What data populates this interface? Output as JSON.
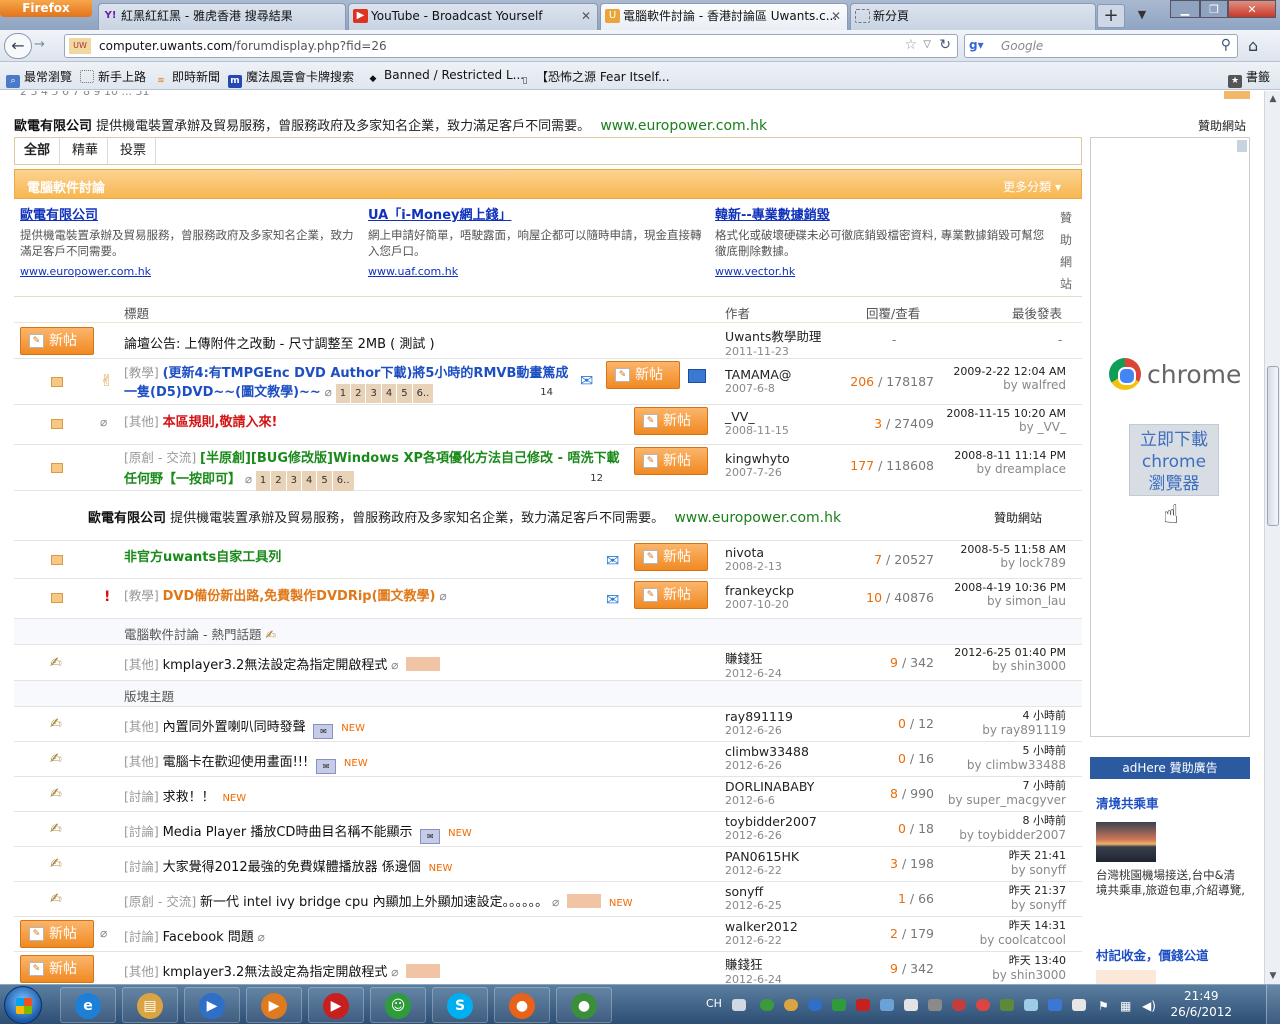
{
  "browser": {
    "app_button": "Firefox",
    "tabs": [
      {
        "label": "紅黑紅紅黑 - 雅虎香港 搜尋結果",
        "favicon": "Y!",
        "color": "#6d1ea8"
      },
      {
        "label": "YouTube - Broadcast Yourself",
        "favicon": "▶",
        "color": "#d32"
      },
      {
        "label": "電腦軟件討論 - 香港討論區 Uwants.c...",
        "favicon": "U",
        "color": "#e9a53a"
      },
      {
        "label": "新分頁",
        "favicon": "",
        "color": "#fff"
      }
    ],
    "url_host": "computer.uwants.com",
    "url_path": "/forumdisplay.php?fid=26",
    "search_placeholder": "Google",
    "bookmarks": [
      {
        "label": "最常瀏覽",
        "icon": "bookmark-icon"
      },
      {
        "label": "新手上路",
        "icon": "page-icon"
      },
      {
        "label": "即時新聞",
        "icon": "news-icon"
      },
      {
        "label": "魔法風雲會卡牌搜索",
        "icon": "mtg-icon"
      },
      {
        "label": "Banned / Restricted L...",
        "icon": "hat-icon"
      },
      {
        "label": "【恐怖之源 Fear Itself...",
        "icon": "fear-icon"
      }
    ],
    "bookmarks_menu": "書籤"
  },
  "page": {
    "pager_cut": "2 3 4 5 6 7 8 9 10 ... 31",
    "top_ad": {
      "company": "歐電有限公司",
      "text": "提供機電裝置承辦及貿易服務，曾服務政府及多家知名企業，致力滿足客戶不同需要。",
      "url": "www.europower.com.hk",
      "sponsor": "贊助網站"
    },
    "filter_tabs": [
      "全部",
      "精華",
      "投票"
    ],
    "forum_title": "電腦軟件討論",
    "more_categories": "更多分類",
    "text_ads": [
      {
        "title": "歐電有限公司",
        "desc": "提供機電裝置承辦及貿易服務，曾服務政府及多家知名企業，致力滿足客戶不同需要。",
        "url": "www.europower.com.hk"
      },
      {
        "title": "UA「i-Money網上錢」",
        "desc": "網上申請好簡單，唔駛露面，响屋企都可以隨時申請，現金直接轉入您戶口。",
        "url": "www.uaf.com.hk"
      },
      {
        "title": "韓新--專業數據銷毀",
        "desc": "格式化或破壞硬碟未必可徹底銷毀檔密資料, 專業數據銷毀可幫您徹底刪除數據。",
        "url": "www.vector.hk"
      }
    ],
    "text_ads_sponsor": "贊助網站",
    "columns": {
      "subject": "標題",
      "author": "作者",
      "replies": "回覆/查看",
      "last": "最後發表"
    },
    "new_post_label": "新帖",
    "announcement": {
      "text": "論壇公告: 上傳附件之改動 - 尺寸調整至 2MB ( 測試 )",
      "author": "Uwants教學助理",
      "date": "2011-11-23",
      "stats": "-",
      "last": "-"
    },
    "sticky_threads": [
      {
        "cat": "[教學]",
        "title": "(更新4:有TMPGEnc DVD Author下載)將5小時的RMVB動畫篤成一隻(D5)DVD~~(圖文教學)~~",
        "pages": [
          "1",
          "2",
          "3",
          "4",
          "5",
          "6..",
          "14"
        ],
        "author": "TAMAMA@",
        "date": "2007-6-8",
        "replies": "206",
        "views": "178187",
        "last_time": "2009-2-22 12:04 AM",
        "last_by": "by walfred"
      },
      {
        "cat": "[其他]",
        "title": "本區規則,敬請入來!",
        "pages": [],
        "author": "_VV_",
        "date": "2008-11-15",
        "replies": "3",
        "views": "27409",
        "last_time": "2008-11-15 10:20 AM",
        "last_by": "by _VV_"
      },
      {
        "cat": "[原創 - 交流]",
        "title": "[半原創][BUG修改版]Windows XP各項優化方法自己修改 - 唔洗下載任何野【一按即可】",
        "pages": [
          "1",
          "2",
          "3",
          "4",
          "5",
          "6..",
          "12"
        ],
        "author": "kingwhyto",
        "date": "2007-7-26",
        "replies": "177",
        "views": "118608",
        "last_time": "2008-8-11 11:14 PM",
        "last_by": "by dreamplace"
      }
    ],
    "mid_ad": {
      "company": "歐電有限公司",
      "text": "提供機電裝置承辦及貿易服務，曾服務政府及多家知名企業，致力滿足客戶不同需要。",
      "url": "www.europower.com.hk",
      "sponsor": "贊助網站"
    },
    "featured_threads": [
      {
        "cat": "",
        "title": "非官方uwants自家工具列",
        "author": "nivota",
        "date": "2008-2-13",
        "replies": "7",
        "views": "20527",
        "last_time": "2008-5-5 11:58 AM",
        "last_by": "by lock789"
      },
      {
        "cat": "[教學]",
        "title": "DVD備份新出路,免費製作DVDRip(圖文教學)",
        "author": "frankeyckp",
        "date": "2007-10-20",
        "replies": "10",
        "views": "40876",
        "last_time": "2008-4-19 10:36 PM",
        "last_by": "by simon_lau"
      }
    ],
    "hot_label": "電腦軟件討論 - 熱門話題",
    "hot_threads": [
      {
        "cat": "[其他]",
        "title": "kmplayer3.2無法設定為指定開啟程式",
        "author": "賺錢狂",
        "date": "2012-6-24",
        "replies": "9",
        "views": "342",
        "last_time": "2012-6-25 01:40 PM",
        "last_by": "by shin3000"
      }
    ],
    "board_label": "版塊主題",
    "threads": [
      {
        "cat": "[其他]",
        "title": "內置同外置喇叭同時發聲",
        "new": "NEW",
        "author": "ray891119",
        "date": "2012-6-26",
        "replies": "0",
        "views": "12",
        "last_time": "4 小時前",
        "last_by": "by ray891119"
      },
      {
        "cat": "[其他]",
        "title": "電腦卡在歡迎使用畫面!!!",
        "new": "NEW",
        "author": "climbw33488",
        "date": "2012-6-26",
        "replies": "0",
        "views": "16",
        "last_time": "5 小時前",
        "last_by": "by climbw33488"
      },
      {
        "cat": "[討論]",
        "title": "求救！！",
        "new": "NEW",
        "author": "DORLINABABY",
        "date": "2012-6-6",
        "replies": "8",
        "views": "990",
        "last_time": "7 小時前",
        "last_by": "by super_macgyver"
      },
      {
        "cat": "[討論]",
        "title": "Media Player 播放CD時曲目名稱不能顯示",
        "new": "NEW",
        "author": "toybidder2007",
        "date": "2012-6-26",
        "replies": "0",
        "views": "18",
        "last_time": "8 小時前",
        "last_by": "by toybidder2007"
      },
      {
        "cat": "[討論]",
        "title": "大家覺得2012最強的免費媒體播放器 係邊個",
        "new": "NEW",
        "author": "PAN0615HK",
        "date": "2012-6-22",
        "replies": "3",
        "views": "198",
        "last_time": "昨天 21:41",
        "last_by": "by sonyff"
      },
      {
        "cat": "[原創 - 交流]",
        "title": "新一代 intel ivy bridge cpu 內顯加上外顯加速設定。。。。。。",
        "new": "NEW",
        "author": "sonyff",
        "date": "2012-6-25",
        "replies": "1",
        "views": "66",
        "last_time": "昨天 21:37",
        "last_by": "by sonyff"
      },
      {
        "cat": "[討論]",
        "title": "Facebook 問題",
        "new": "",
        "author": "walker2012",
        "date": "2012-6-22",
        "replies": "2",
        "views": "179",
        "last_time": "昨天 14:31",
        "last_by": "by coolcatcool"
      },
      {
        "cat": "[其他]",
        "title": "kmplayer3.2無法設定為指定開啟程式",
        "new": "",
        "author": "賺錢狂",
        "date": "2012-6-24",
        "replies": "9",
        "views": "342",
        "last_time": "昨天 13:40",
        "last_by": "by shin3000"
      }
    ],
    "chrome_ad": {
      "word": "chrome",
      "download": "立即下載\nchrome\n瀏覽器"
    },
    "adhere": {
      "header": "adHere 贊助廣告",
      "items": [
        {
          "title": "清境共乘車",
          "desc": "台灣桃園機場接送,台中&清境共乘車,旅遊包車,介紹導覽,"
        },
        {
          "title": "村記收金，價錢公道",
          "desc": ""
        }
      ]
    }
  },
  "taskbar": {
    "lang": "CH",
    "time": "21:49",
    "date": "26/6/2012",
    "apps": [
      {
        "name": "ie",
        "glyph": "e",
        "color": "#1d7fd6"
      },
      {
        "name": "explorer",
        "glyph": "▤",
        "color": "#d9a441"
      },
      {
        "name": "media-player",
        "glyph": "▶",
        "color": "#2f6fc8"
      },
      {
        "name": "media-center",
        "glyph": "▶",
        "color": "#e07a1e"
      },
      {
        "name": "kmplayer",
        "glyph": "▶",
        "color": "#c8201e"
      },
      {
        "name": "messenger",
        "glyph": "☺",
        "color": "#2e9c3a"
      },
      {
        "name": "skype",
        "glyph": "S",
        "color": "#00aff0"
      },
      {
        "name": "firefox",
        "glyph": "●",
        "color": "#e8621a"
      },
      {
        "name": "chrome",
        "glyph": "●",
        "color": "#3b8f3a"
      }
    ]
  }
}
